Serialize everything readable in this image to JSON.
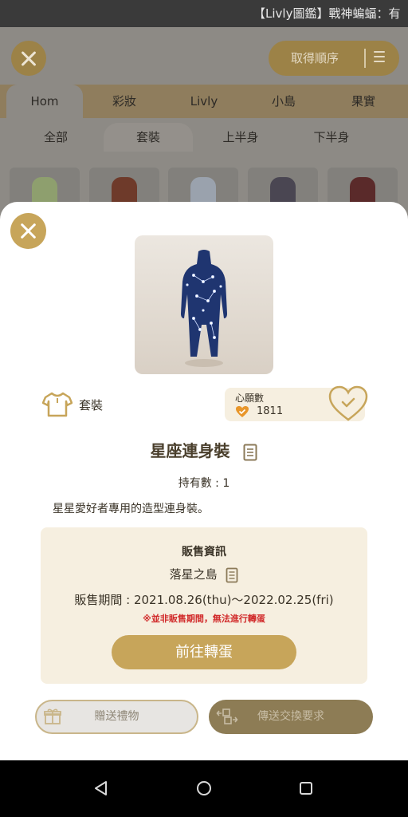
{
  "status_bar": {
    "text": "【Livly圖鑑】戰神蝙蝠：有"
  },
  "background": {
    "sort_button": {
      "label": "取得順序",
      "icon": "sort-lines-icon"
    },
    "categories": [
      "Hom",
      "彩妝",
      "Livly",
      "小島",
      "果實"
    ],
    "active_category": "Hom",
    "subcategories": [
      "全部",
      "套裝",
      "上半身",
      "下半身"
    ],
    "active_subcategory": "套裝"
  },
  "item": {
    "category_label": "套裝",
    "category_icon": "shirt-icon",
    "wish": {
      "label": "心願數",
      "count": "1811"
    },
    "name": "星座連身裝",
    "owned": "持有數 : 1",
    "description": "星星愛好者專用的造型連身裝。"
  },
  "sale": {
    "title": "販售資訊",
    "place": "落星之島",
    "period": "販售期間 : 2021.08.26(thu)〜2022.02.25(fri)",
    "warning": "※並非販售期間，無法進行轉蛋",
    "go_button": "前往轉蛋"
  },
  "actions": {
    "gift": "贈送禮物",
    "trade": "傳送交換要求"
  },
  "colors": {
    "accent": "#c7a55a",
    "panel": "#f6efe0",
    "warning": "#d12b2b",
    "text": "#3a3327"
  }
}
